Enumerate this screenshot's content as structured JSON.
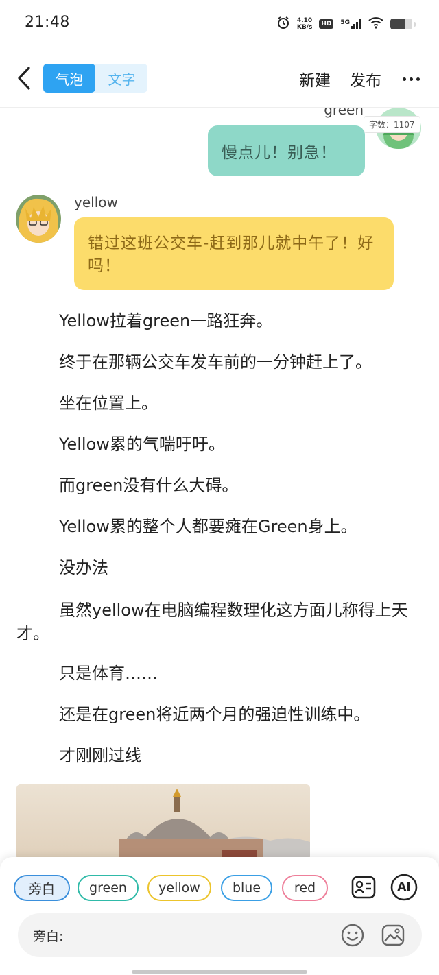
{
  "status_bar": {
    "time": "21:48",
    "net_speed_value": "4.10",
    "net_speed_unit": "KB/s",
    "hd_badge": "HD",
    "signal_label": "5G",
    "icons": [
      "alarm-icon",
      "hd-icon",
      "signal-5g-icon",
      "wifi-icon",
      "battery-icon"
    ],
    "battery_level": 0.7
  },
  "header": {
    "tabs": [
      {
        "label": "气泡",
        "active": true
      },
      {
        "label": "文字",
        "active": false
      }
    ],
    "new_label": "新建",
    "publish_label": "发布"
  },
  "chat": {
    "green": {
      "name": "green",
      "message": "慢点儿！别急！"
    },
    "word_count": "字数：1107",
    "yellow": {
      "name": "yellow",
      "message": "错过这班公交车-赶到那儿就中午了！好吗！"
    }
  },
  "story": [
    "Yellow拉着green一路狂奔。",
    "终于在那辆公交车发车前的一分钟赶上了。",
    "坐在位置上。",
    "Yellow累的气喘吁吁。",
    "而green没有什么大碍。",
    "Yellow累的整个人都要瘫在Green身上。",
    "没办法",
    "虽然yellow在电脑编程数理化这方面儿称得上天才。",
    "只是体育……",
    "还是在green将近两个月的强迫性训练中。",
    "才刚刚过线"
  ],
  "characters": [
    {
      "label": "旁白",
      "selected": true
    },
    {
      "label": "green",
      "selected": false
    },
    {
      "label": "yellow",
      "selected": false
    },
    {
      "label": "blue",
      "selected": false
    },
    {
      "label": "red",
      "selected": false
    }
  ],
  "toolbar": {
    "ai_label": "AI"
  },
  "input": {
    "label": "旁白:"
  },
  "colors": {
    "accent": "#2ea3f2",
    "green_bubble": "#8ed8c8",
    "yellow_bubble": "#fcdc6b",
    "chip_green": "#2fbaa8",
    "chip_yellow": "#ecc42c",
    "chip_blue": "#3a9fe5",
    "chip_red": "#ee7f9a"
  }
}
